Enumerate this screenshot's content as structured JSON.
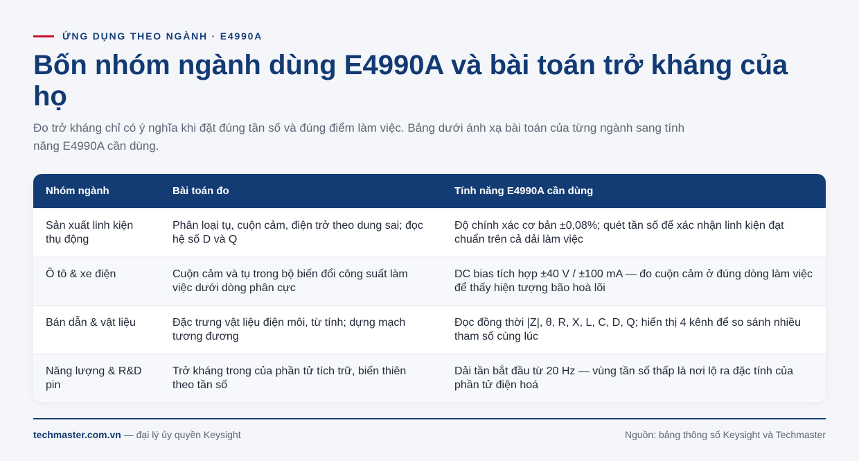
{
  "eyebrow": "ỨNG DỤNG THEO NGÀNH · E4990A",
  "title": "Bốn nhóm ngành dùng E4990A và bài toán trở kháng của họ",
  "subtitle": "Đo trở kháng chỉ có ý nghĩa khi đặt đúng tần số và đúng điểm làm việc. Bảng dưới ánh xạ bài toán của từng ngành sang tính năng E4990A cần dùng.",
  "table": {
    "headers": [
      "Nhóm ngành",
      "Bài toán đo",
      "Tính năng E4990A cần dùng"
    ],
    "rows": [
      [
        "Sản xuất linh kiện thụ động",
        "Phân loại tụ, cuộn cảm, điện trở theo dung sai; đọc hệ số D và Q",
        "Độ chính xác cơ bản ±0,08%; quét tần số để xác nhận linh kiện đạt chuẩn trên cả dải làm việc"
      ],
      [
        "Ô tô & xe điện",
        "Cuộn cảm và tụ trong bộ biến đổi công suất làm việc dưới dòng phân cực",
        "DC bias tích hợp ±40 V / ±100 mA — đo cuộn cảm ở đúng dòng làm việc để thấy hiện tượng bão hoà lõi"
      ],
      [
        "Bán dẫn & vật liệu",
        "Đặc trưng vật liệu điện môi, từ tính; dựng mạch tương đương",
        "Đọc đồng thời |Z|, θ, R, X, L, C, D, Q; hiển thị 4 kênh để so sánh nhiều tham số cùng lúc"
      ],
      [
        "Năng lượng & R&D pin",
        "Trở kháng trong của phần tử tích trữ, biến thiên theo tần số",
        "Dải tần bắt đầu từ 20 Hz — vùng tần số thấp là nơi lộ ra đặc tính của phần tử điện hoá"
      ]
    ]
  },
  "footer": {
    "brand": "techmaster.com.vn",
    "brand_suffix": " — đại lý ủy quyền Keysight",
    "source": "Nguồn: bảng thông số Keysight và Techmaster"
  },
  "colors": {
    "accent": "#c8102e",
    "navy": "#133c75"
  }
}
